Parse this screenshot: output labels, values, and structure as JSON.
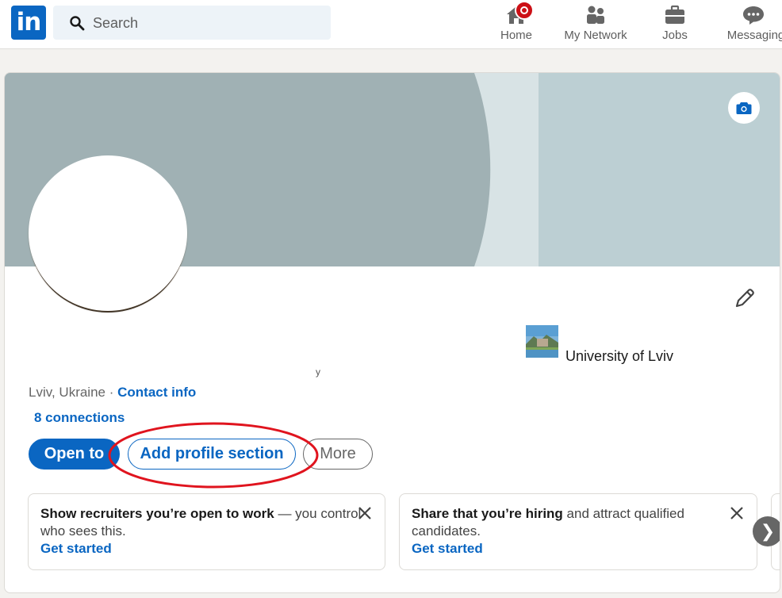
{
  "nav": {
    "logo_text": "in",
    "search_placeholder": "Search",
    "items": [
      {
        "label": "Home",
        "icon": "home-icon"
      },
      {
        "label": "My Network",
        "icon": "network-icon"
      },
      {
        "label": "Jobs",
        "icon": "briefcase-icon"
      },
      {
        "label": "Messaging",
        "icon": "chat-icon"
      }
    ]
  },
  "profile": {
    "education": "University of Lviv",
    "location": "Lviv, Ukraine",
    "separator": " · ",
    "contact_info": "Contact info",
    "connections": "8 connections",
    "tiny_mark": "y"
  },
  "actions": {
    "open_to": "Open to",
    "add_profile_section": "Add profile section",
    "more": "More"
  },
  "promos": [
    {
      "bold": "Show recruiters you’re open to work",
      "rest": " — you control who sees this.",
      "link": "Get started"
    },
    {
      "bold": "Share that you’re hiring",
      "rest": " and attract qualified candidates.",
      "link": "Get started"
    }
  ],
  "next_arrow": "❯",
  "colors": {
    "brand": "#0a66c2",
    "banner_left": "#a0b1b4",
    "banner_mid": "#d8e3e5",
    "banner_right": "#bccfd3",
    "highlight": "#e0141e",
    "notification": "#cc1016"
  }
}
